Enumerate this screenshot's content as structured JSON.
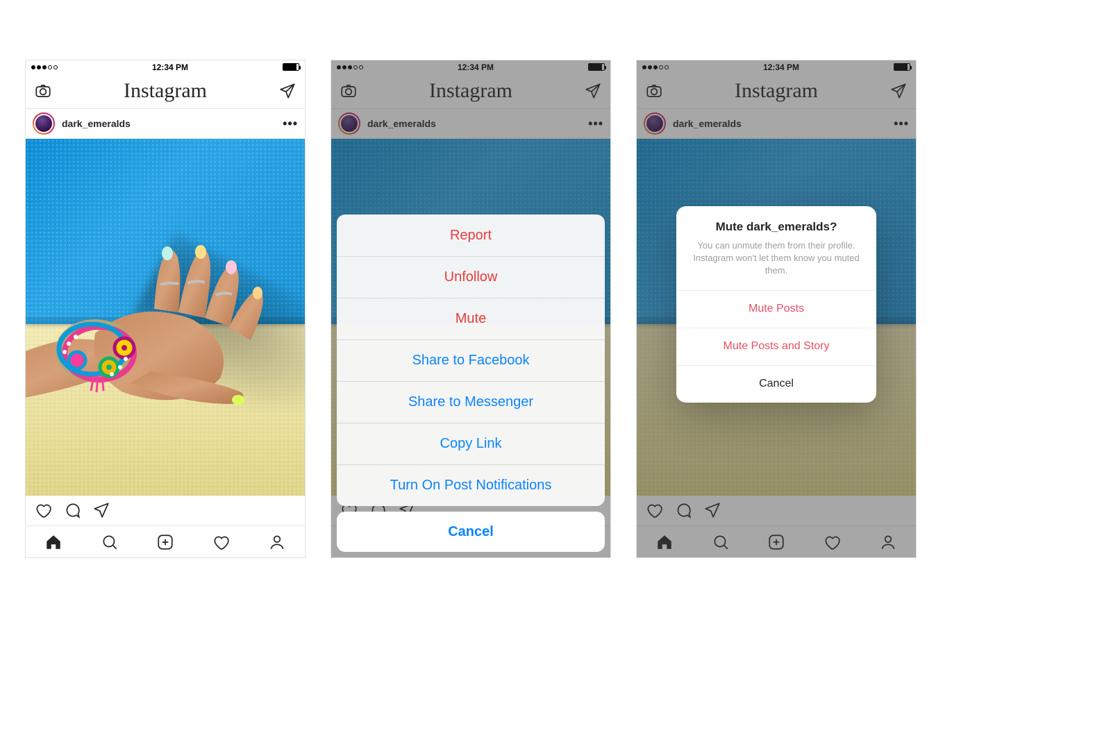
{
  "statusbar": {
    "time": "12:34 PM",
    "signal_filled": 3,
    "signal_total": 5
  },
  "header": {
    "logo_text": "Instagram"
  },
  "post": {
    "username": "dark_emeralds",
    "more_glyph": "•••"
  },
  "actionsheet": {
    "items": [
      {
        "label": "Report",
        "style": "red"
      },
      {
        "label": "Unfollow",
        "style": "red"
      },
      {
        "label": "Mute",
        "style": "red"
      },
      {
        "label": "Share to Facebook",
        "style": "blue"
      },
      {
        "label": "Share to Messenger",
        "style": "blue"
      },
      {
        "label": "Copy Link",
        "style": "blue"
      },
      {
        "label": "Turn On Post Notifications",
        "style": "blue"
      }
    ],
    "cancel": "Cancel"
  },
  "mutealert": {
    "title": "Mute dark_emeralds?",
    "message": "You can unmute them from their profile. Instagram won't let them know you muted them.",
    "buttons": {
      "mute_posts": "Mute Posts",
      "mute_posts_and_story": "Mute Posts and Story",
      "cancel": "Cancel"
    }
  }
}
